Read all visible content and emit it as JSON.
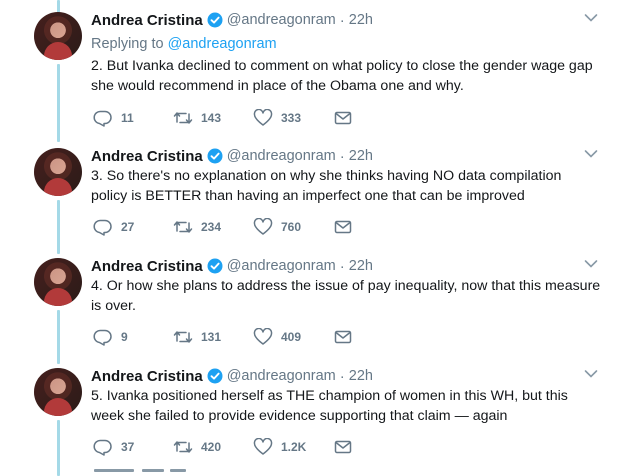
{
  "tweets": [
    {
      "name": "Andrea Cristina",
      "handle": "@andreagonram",
      "separator": "·",
      "time": "22h",
      "replying_label": "Replying to",
      "replying_handle": "@andreagonram",
      "lines": [
        "2. But Ivanka declined to comment on what policy to close the gender wage gap",
        "she would recommend in place of the Obama one and why."
      ],
      "replies": "11",
      "retweets": "143",
      "likes": "333"
    },
    {
      "name": "Andrea Cristina",
      "handle": "@andreagonram",
      "separator": "·",
      "time": "22h",
      "lines": [
        "3. So there's no explanation on why she thinks having NO data compilation",
        "policy is BETTER than having an imperfect one that can be improved"
      ],
      "replies": "27",
      "retweets": "234",
      "likes": "760"
    },
    {
      "name": "Andrea Cristina",
      "handle": "@andreagonram",
      "separator": "·",
      "time": "22h",
      "lines": [
        "4. Or how she plans to address the issue of pay inequality, now that this measure",
        "is over."
      ],
      "replies": "9",
      "retweets": "131",
      "likes": "409"
    },
    {
      "name": "Andrea Cristina",
      "handle": "@andreagonram",
      "separator": "·",
      "time": "22h",
      "lines": [
        "5. Ivanka positioned herself as THE champion of women in this WH, but this",
        "week she failed to provide evidence supporting that claim — again"
      ],
      "replies": "37",
      "retweets": "420",
      "likes": "1.2K"
    }
  ],
  "icons": {
    "verified": "verified-badge-icon",
    "chevron": "chevron-down-icon",
    "reply": "reply-icon",
    "retweet": "retweet-icon",
    "like": "heart-icon",
    "dm": "envelope-icon"
  },
  "colors": {
    "thread_line": "#a4d9e7",
    "link": "#1da1f2",
    "verified": "#1da1f2",
    "muted": "#657786",
    "text": "#14171a"
  }
}
